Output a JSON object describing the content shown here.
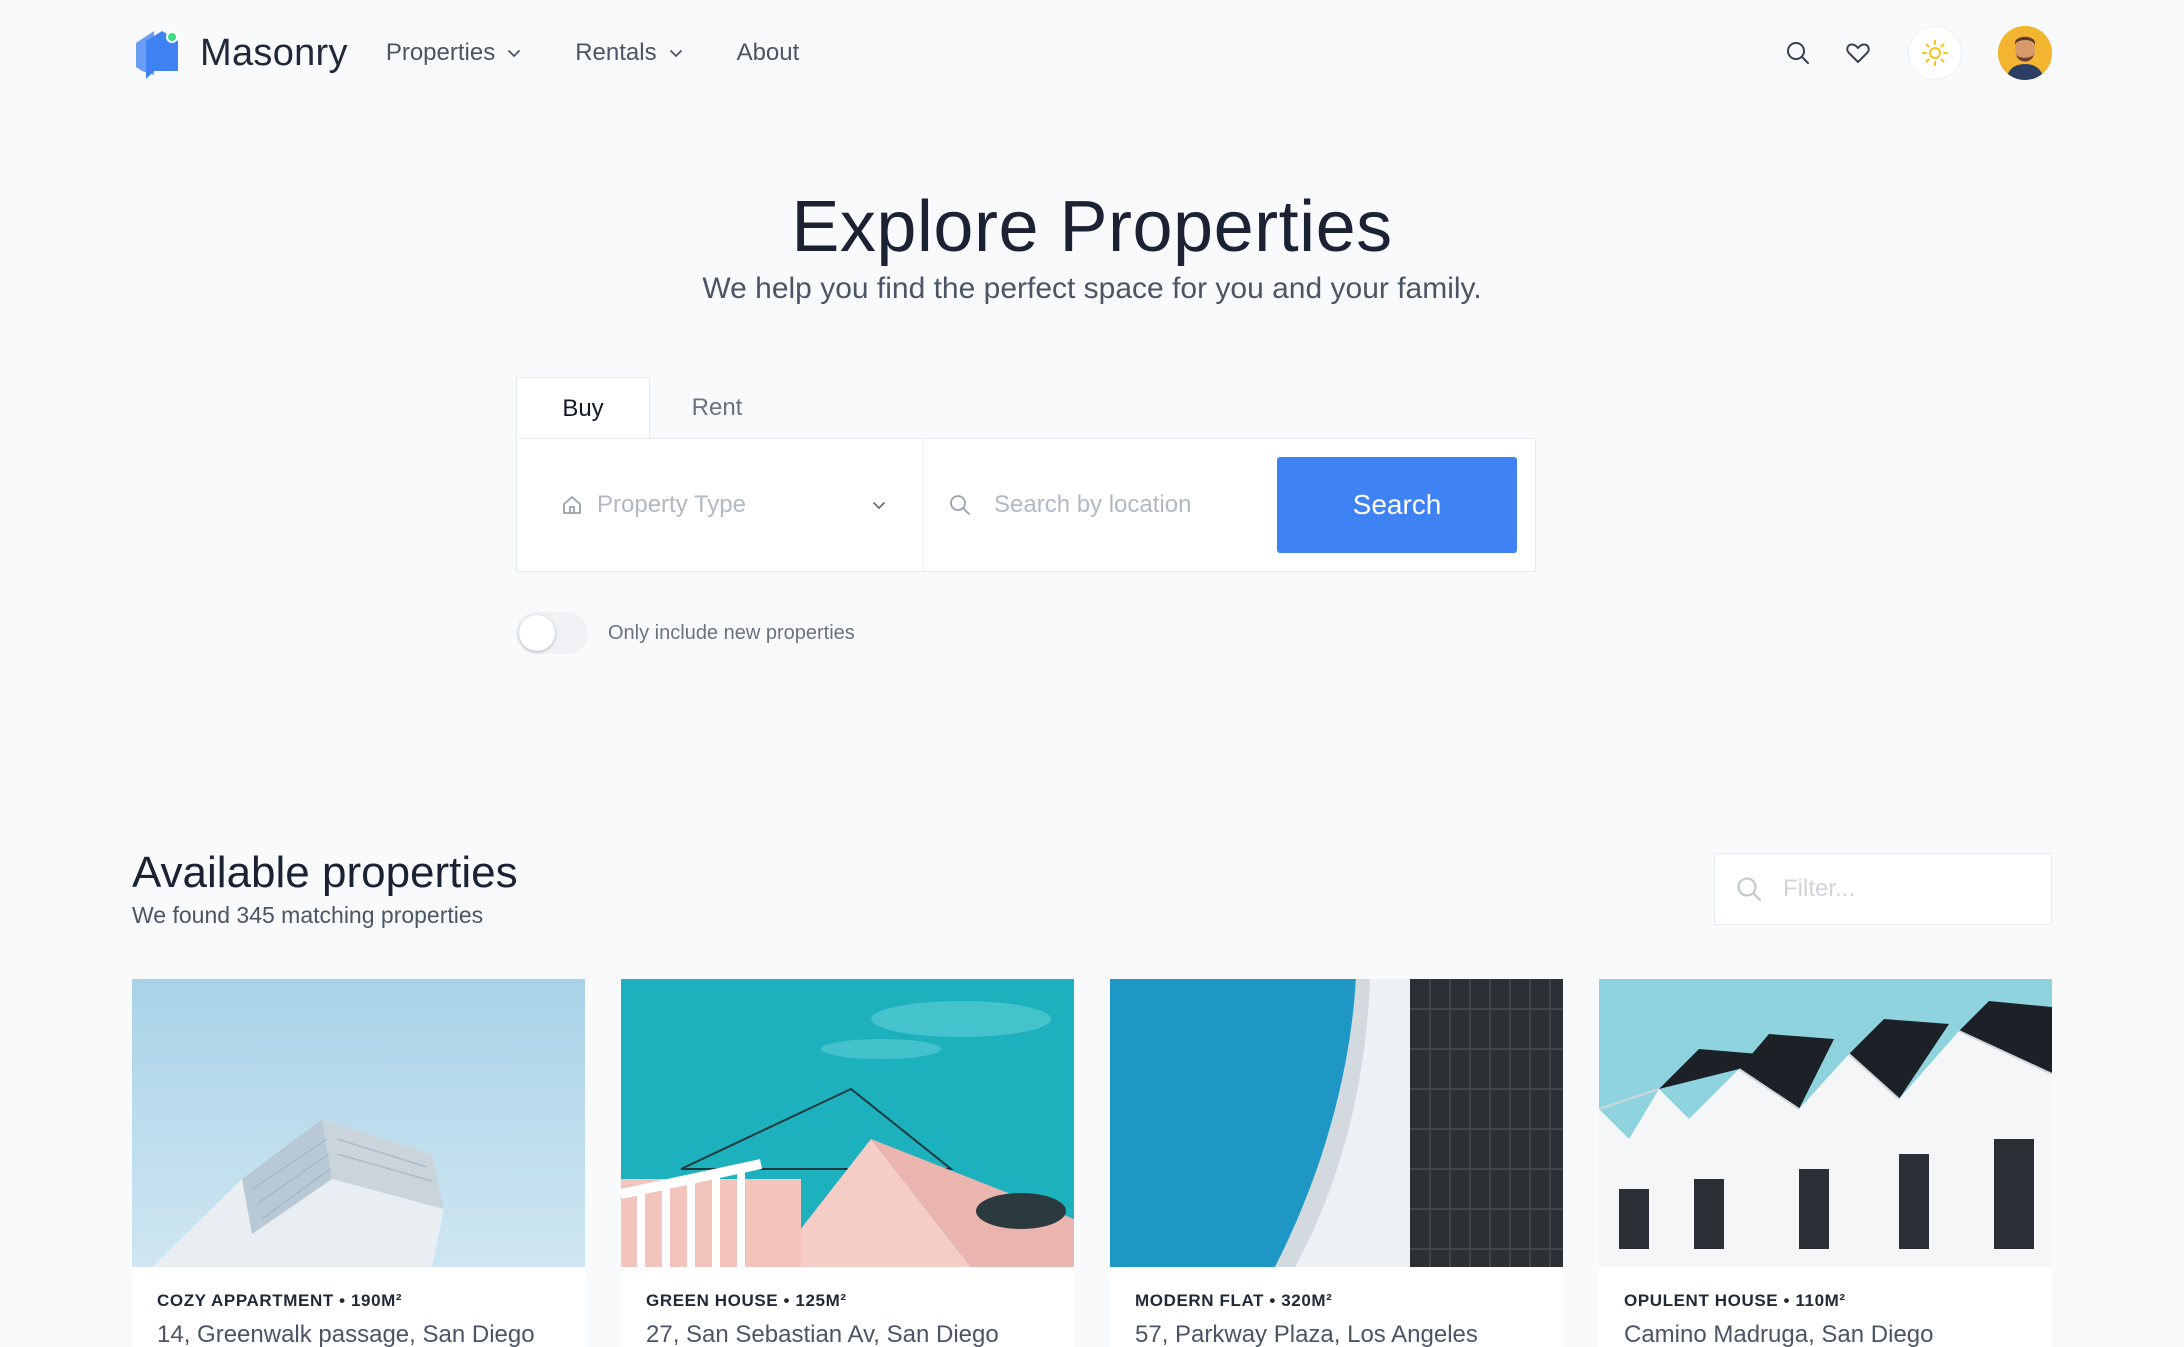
{
  "brand": {
    "name": "Masonry"
  },
  "nav": {
    "links": [
      {
        "label": "Properties",
        "has_dropdown": true
      },
      {
        "label": "Rentals",
        "has_dropdown": true
      },
      {
        "label": "About",
        "has_dropdown": false
      }
    ],
    "icons": [
      "search-icon",
      "heart-icon",
      "sun-icon",
      "avatar"
    ]
  },
  "hero": {
    "title": "Explore Properties",
    "subtitle": "We help you find the perfect space for you and your family."
  },
  "search": {
    "tabs": [
      {
        "label": "Buy",
        "active": true
      },
      {
        "label": "Rent",
        "active": false
      }
    ],
    "property_type_placeholder": "Property Type",
    "location_placeholder": "Search by location",
    "button_label": "Search",
    "toggle_label": "Only include new properties",
    "toggle_on": false
  },
  "listing": {
    "title": "Available properties",
    "subtitle": "We found 345 matching properties",
    "filter_placeholder": "Filter..."
  },
  "cards": [
    {
      "meta": "COZY APPARTMENT • 190M²",
      "address": "14, Greenwalk passage, San Diego"
    },
    {
      "meta": "GREEN HOUSE • 125M²",
      "address": "27, San Sebastian Av, San Diego"
    },
    {
      "meta": "MODERN FLAT • 320M²",
      "address": "57, Parkway Plaza, Los Angeles"
    },
    {
      "meta": "OPULENT HOUSE • 110M²",
      "address": "Camino Madruga, San Diego"
    }
  ],
  "colors": {
    "accent": "#3f82f4",
    "background": "#f9fafc",
    "sun": "#f5c518"
  }
}
